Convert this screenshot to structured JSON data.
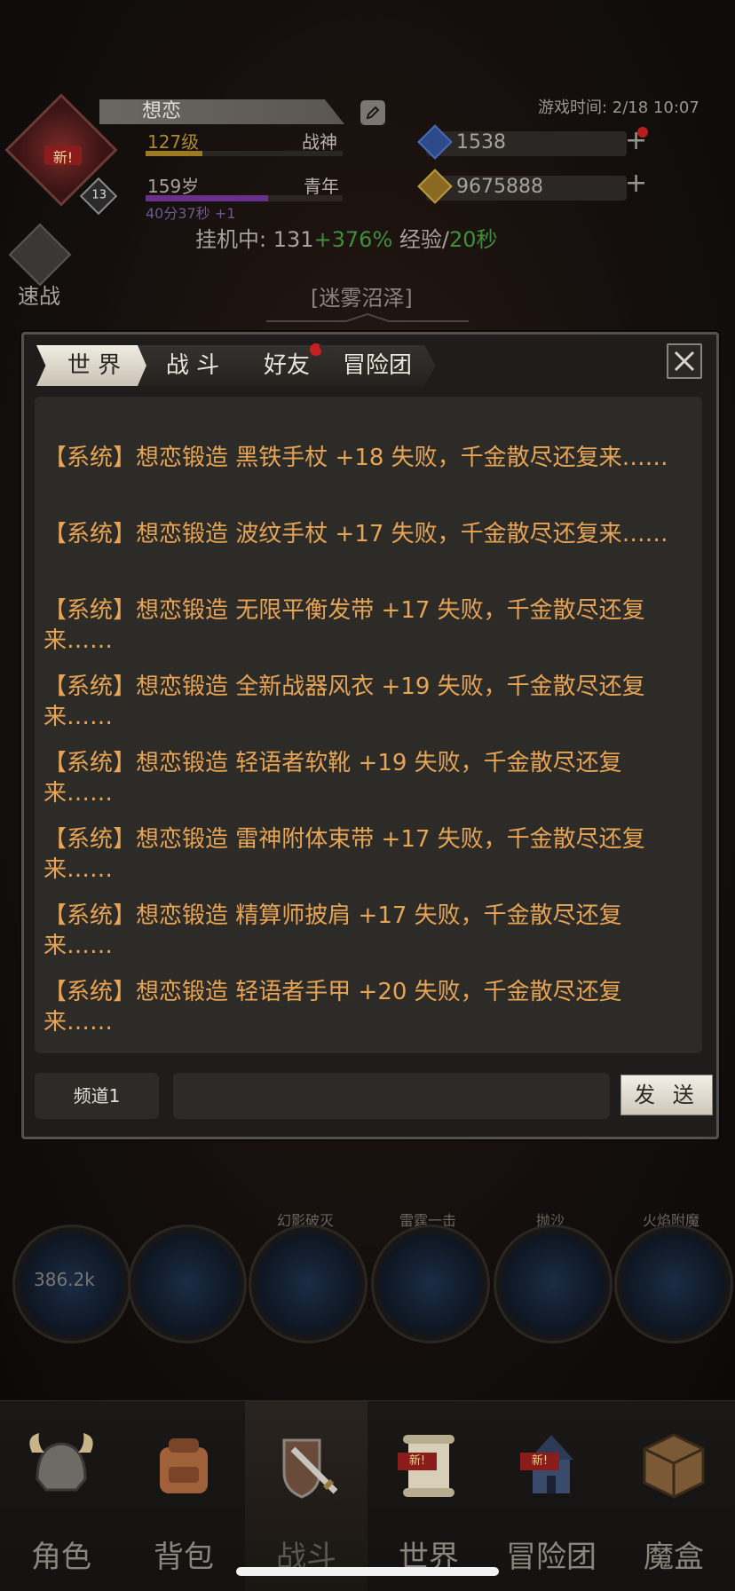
{
  "header": {
    "player_name": "想恋",
    "level_text": "127级",
    "level_progress": 0.29,
    "title_text": "战神",
    "age_text": "159岁",
    "life_stage": "青年",
    "age_progress": 0.62,
    "age_timer": "40分37秒 +1",
    "avatar_badge": "新!",
    "avatar_level": "13",
    "game_time": "游戏时间: 2/18 10:07",
    "gems": "1538",
    "gold": "9675888",
    "idle_prefix": "挂机中: 131",
    "idle_bonus": "+376%",
    "idle_exp": " 经验/",
    "idle_rate": "20秒",
    "quick_battle": "速战",
    "area_name": "[迷雾沼泽]"
  },
  "skills": {
    "hp_value": "386.2k",
    "labels": [
      "幻影破灭",
      "雷霆一击",
      "抛沙",
      "火焰附魔"
    ]
  },
  "chat": {
    "tabs": [
      "世 界",
      "战 斗",
      "好友",
      "冒险团"
    ],
    "active_tab": "世 界",
    "messages": [
      "【系统】想恋锻造 黑铁手杖 +18 失败，千金散尽还复来……",
      "【系统】想恋锻造 波纹手杖 +17 失败，千金散尽还复来……",
      "【系统】想恋锻造 无限平衡发带 +17 失败，千金散尽还复来……",
      "【系统】想恋锻造 全新战器风衣 +19 失败，千金散尽还复来……",
      "【系统】想恋锻造 轻语者软靴 +19 失败，千金散尽还复来……",
      "【系统】想恋锻造 雷神附体束带 +17 失败，千金散尽还复来……",
      "【系统】想恋锻造 精算师披肩 +17 失败，千金散尽还复来……",
      "【系统】想恋锻造 轻语者手甲 +20 失败，千金散尽还复来……"
    ],
    "channel": "频道1",
    "input_value": "",
    "send_label": "发 送"
  },
  "nav": {
    "items": [
      "角色",
      "背包",
      "战斗",
      "世界",
      "冒险团",
      "魔盒"
    ],
    "active": "战斗",
    "new_badge": "新!"
  }
}
